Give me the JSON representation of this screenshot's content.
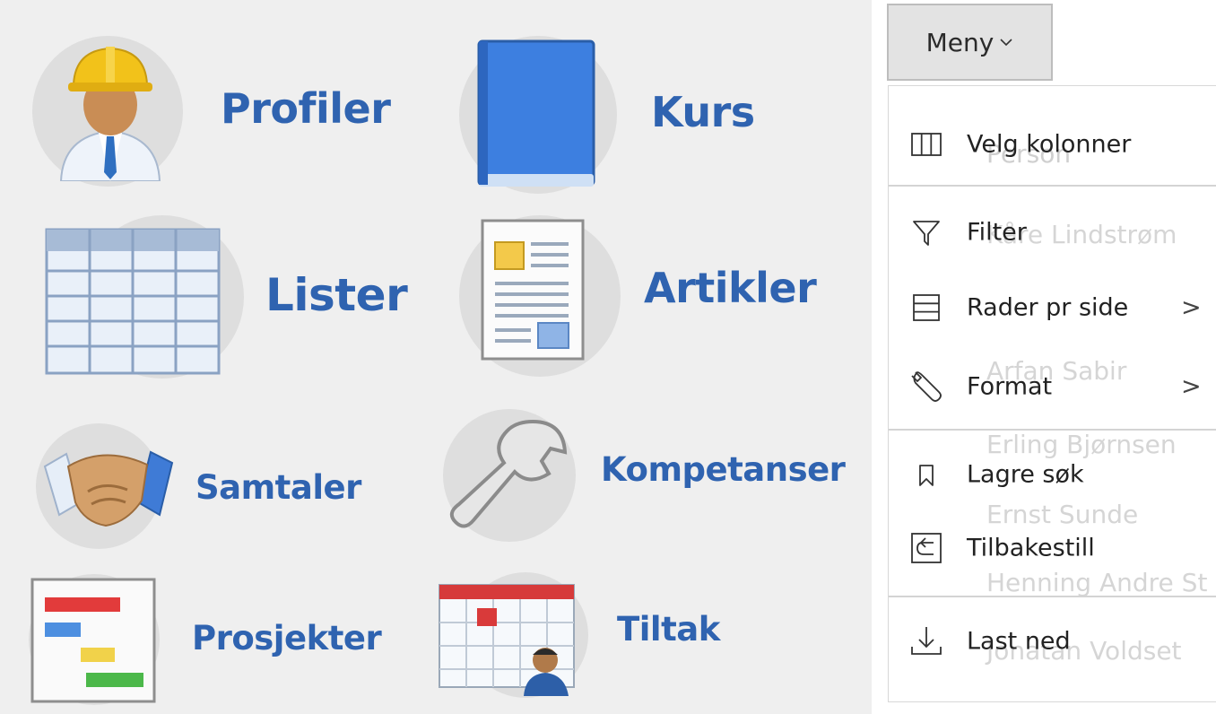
{
  "tiles": {
    "profiler": "Profiler",
    "kurs": "Kurs",
    "lister": "Lister",
    "artikler": "Artikler",
    "samtaler": "Samtaler",
    "kompetanser": "Kompetanser",
    "prosjekter": "Prosjekter",
    "tiltak": "Tiltak"
  },
  "menu_button": {
    "label": "Meny",
    "icon": "chevron-down-icon"
  },
  "menu": {
    "items": [
      {
        "label": "Velg kolonner",
        "icon": "columns-icon"
      },
      {
        "label": "Filter",
        "icon": "filter-icon"
      },
      {
        "label": "Rader pr side",
        "icon": "rows-icon",
        "chevron": ">"
      },
      {
        "label": "Format",
        "icon": "wrench-icon",
        "chevron": ">"
      },
      {
        "label": "Lagre søk",
        "icon": "bookmark-icon"
      },
      {
        "label": "Tilbakestill",
        "icon": "reset-icon"
      },
      {
        "label": "Last ned",
        "icon": "download-icon"
      }
    ]
  },
  "background_table": {
    "header": "Person",
    "rows": [
      "Kåre Lindstrøm",
      "Arfan Sabir",
      "Erling Bjørnsen",
      "Ernst Sunde",
      "Henning Andre St",
      "Jonatan Voldset"
    ]
  },
  "colors": {
    "tile_label": "#2f63b0",
    "tile_bg": "#efefef",
    "button_bg": "#e3e3e3"
  }
}
